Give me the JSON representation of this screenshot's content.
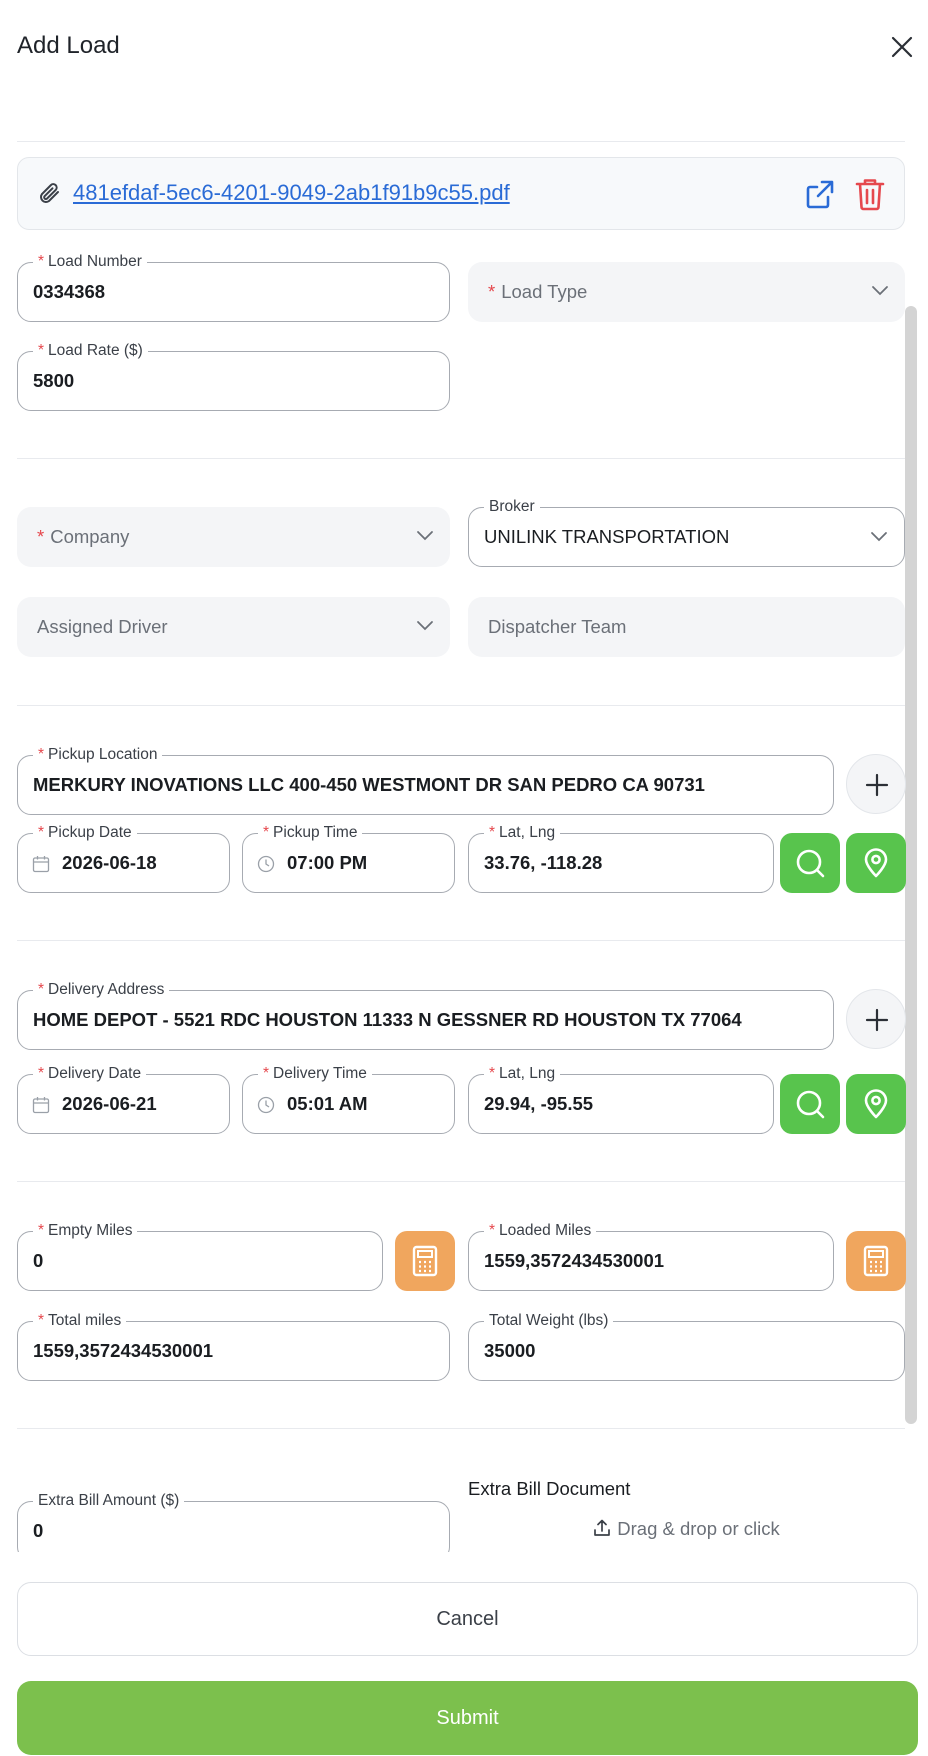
{
  "header": {
    "title": "Add Load"
  },
  "attachment": {
    "filename": "481efdaf-5ec6-4201-9049-2ab1f91b9c55.pdf"
  },
  "load": {
    "load_number_label": "Load Number",
    "load_number": "0334368",
    "load_type_placeholder": "Load Type",
    "load_rate_label": "Load Rate ($)",
    "load_rate": "5800"
  },
  "parties": {
    "company_placeholder": "Company",
    "broker_label": "Broker",
    "broker": "UNILINK TRANSPORTATION",
    "driver_placeholder": "Assigned Driver",
    "dispatcher_placeholder": "Dispatcher Team"
  },
  "pickup": {
    "location_label": "Pickup Location",
    "location": "MERKURY INOVATIONS LLC 400-450 WESTMONT DR SAN PEDRO CA 90731",
    "date_label": "Pickup Date",
    "date": "2026-06-18",
    "time_label": "Pickup Time",
    "time": "07:00 PM",
    "latlng_label": "Lat, Lng",
    "latlng": "33.76, -118.28"
  },
  "delivery": {
    "address_label": "Delivery Address",
    "address": "HOME DEPOT - 5521 RDC HOUSTON 11333 N GESSNER RD HOUSTON TX 77064",
    "date_label": "Delivery Date",
    "date": "2026-06-21",
    "time_label": "Delivery Time",
    "time": "05:01 AM",
    "latlng_label": "Lat, Lng",
    "latlng": "29.94, -95.55"
  },
  "miles": {
    "empty_label": "Empty Miles",
    "empty": "0",
    "loaded_label": "Loaded Miles",
    "loaded": "1559,3572434530001",
    "total_label": "Total miles",
    "total": "1559,3572434530001",
    "weight_label": "Total Weight (lbs)",
    "weight": "35000"
  },
  "extra": {
    "amount_label": "Extra Bill Amount ($)",
    "amount": "0",
    "document_label": "Extra Bill Document",
    "dropzone_text": "Drag & drop or click"
  },
  "actions": {
    "cancel": "Cancel",
    "submit": "Submit"
  },
  "colors": {
    "primary_green": "#7cc04d",
    "icon_green": "#58c44d",
    "calc_orange": "#f0a65e",
    "link_blue": "#2a6bd6",
    "delete_red": "#e5484d"
  }
}
